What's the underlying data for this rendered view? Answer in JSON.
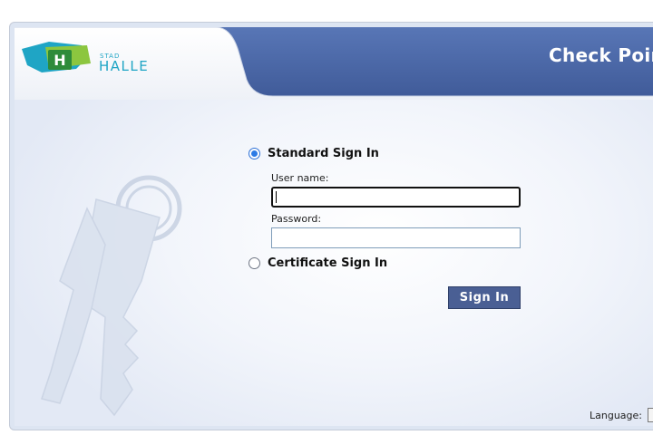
{
  "header": {
    "title": "Check Point",
    "logo": {
      "small_text": "STAD",
      "big_text": "HALLE",
      "icon_letter": "H"
    }
  },
  "colors": {
    "header_blue": "#4c68a6",
    "button_bg": "#4a5f94",
    "logo_green": "#8cc63f",
    "logo_teal": "#1fa5c5",
    "logo_dark_green": "#3a9a3e"
  },
  "login": {
    "standard_option": {
      "label": "Standard Sign In",
      "selected": true
    },
    "username": {
      "label": "User name:",
      "value": "",
      "placeholder": ""
    },
    "password": {
      "label": "Password:",
      "value": "",
      "placeholder": ""
    },
    "certificate_option": {
      "label": "Certificate Sign In",
      "selected": false
    },
    "submit_label": "Sign In"
  },
  "footer": {
    "language_label": "Language:",
    "language_value": ""
  },
  "icons": {
    "background_art": "key-icon",
    "radio_selected": "radio-checked-icon",
    "radio_unselected": "radio-unchecked-icon"
  }
}
